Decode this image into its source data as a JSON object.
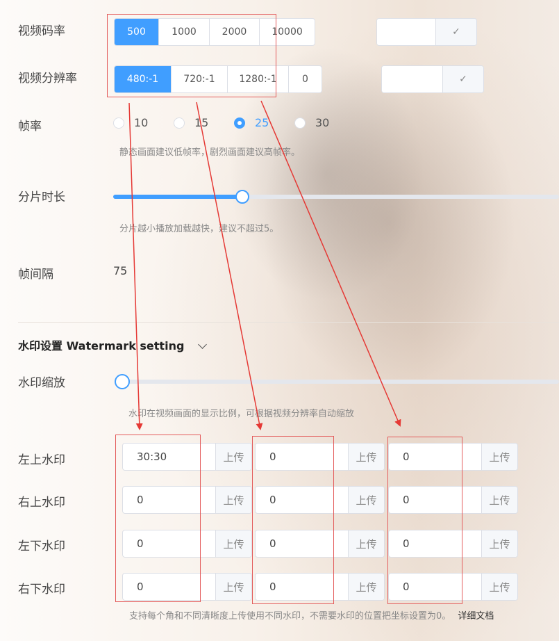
{
  "bitrate": {
    "label": "视频码率",
    "options": [
      "500",
      "1000",
      "2000",
      "10000"
    ],
    "selected": "500",
    "confirm_icon": "check-icon"
  },
  "resolution": {
    "label": "视频分辨率",
    "options": [
      "480:-1",
      "720:-1",
      "1280:-1",
      "0"
    ],
    "selected": "480:-1",
    "confirm_icon": "check-icon"
  },
  "framerate": {
    "label": "帧率",
    "options": [
      "10",
      "15",
      "25",
      "30"
    ],
    "selected": "25",
    "hint": "静态画面建议低帧率，剧烈画面建议高帧率。"
  },
  "segment": {
    "label": "分片时长",
    "value_fraction": 0.29,
    "hint": "分片越小播放加载越快，建议不超过5。"
  },
  "keyframe": {
    "label": "帧间隔",
    "value": "75"
  },
  "watermark": {
    "section_title": "水印设置 Watermark setting",
    "toggle_icon": "chevron-down-icon",
    "scale_label": "水印缩放",
    "scale_fraction": 0.0,
    "scale_hint": "水印在视频画面的显示比例，可根据视频分辨率自动缩放",
    "upload_label": "上传",
    "rows": [
      {
        "label": "左上水印",
        "values": [
          "30:30",
          "0",
          "0"
        ]
      },
      {
        "label": "右上水印",
        "values": [
          "0",
          "0",
          "0"
        ]
      },
      {
        "label": "左下水印",
        "values": [
          "0",
          "0",
          "0"
        ]
      },
      {
        "label": "右下水印",
        "values": [
          "0",
          "0",
          "0"
        ]
      }
    ],
    "footer_hint": "支持每个角和不同清晰度上传使用不同水印，不需要水印的位置把坐标设置为0。",
    "doc_link": "详细文档"
  },
  "colors": {
    "primary": "#409eff",
    "annotation": "#e53935"
  }
}
